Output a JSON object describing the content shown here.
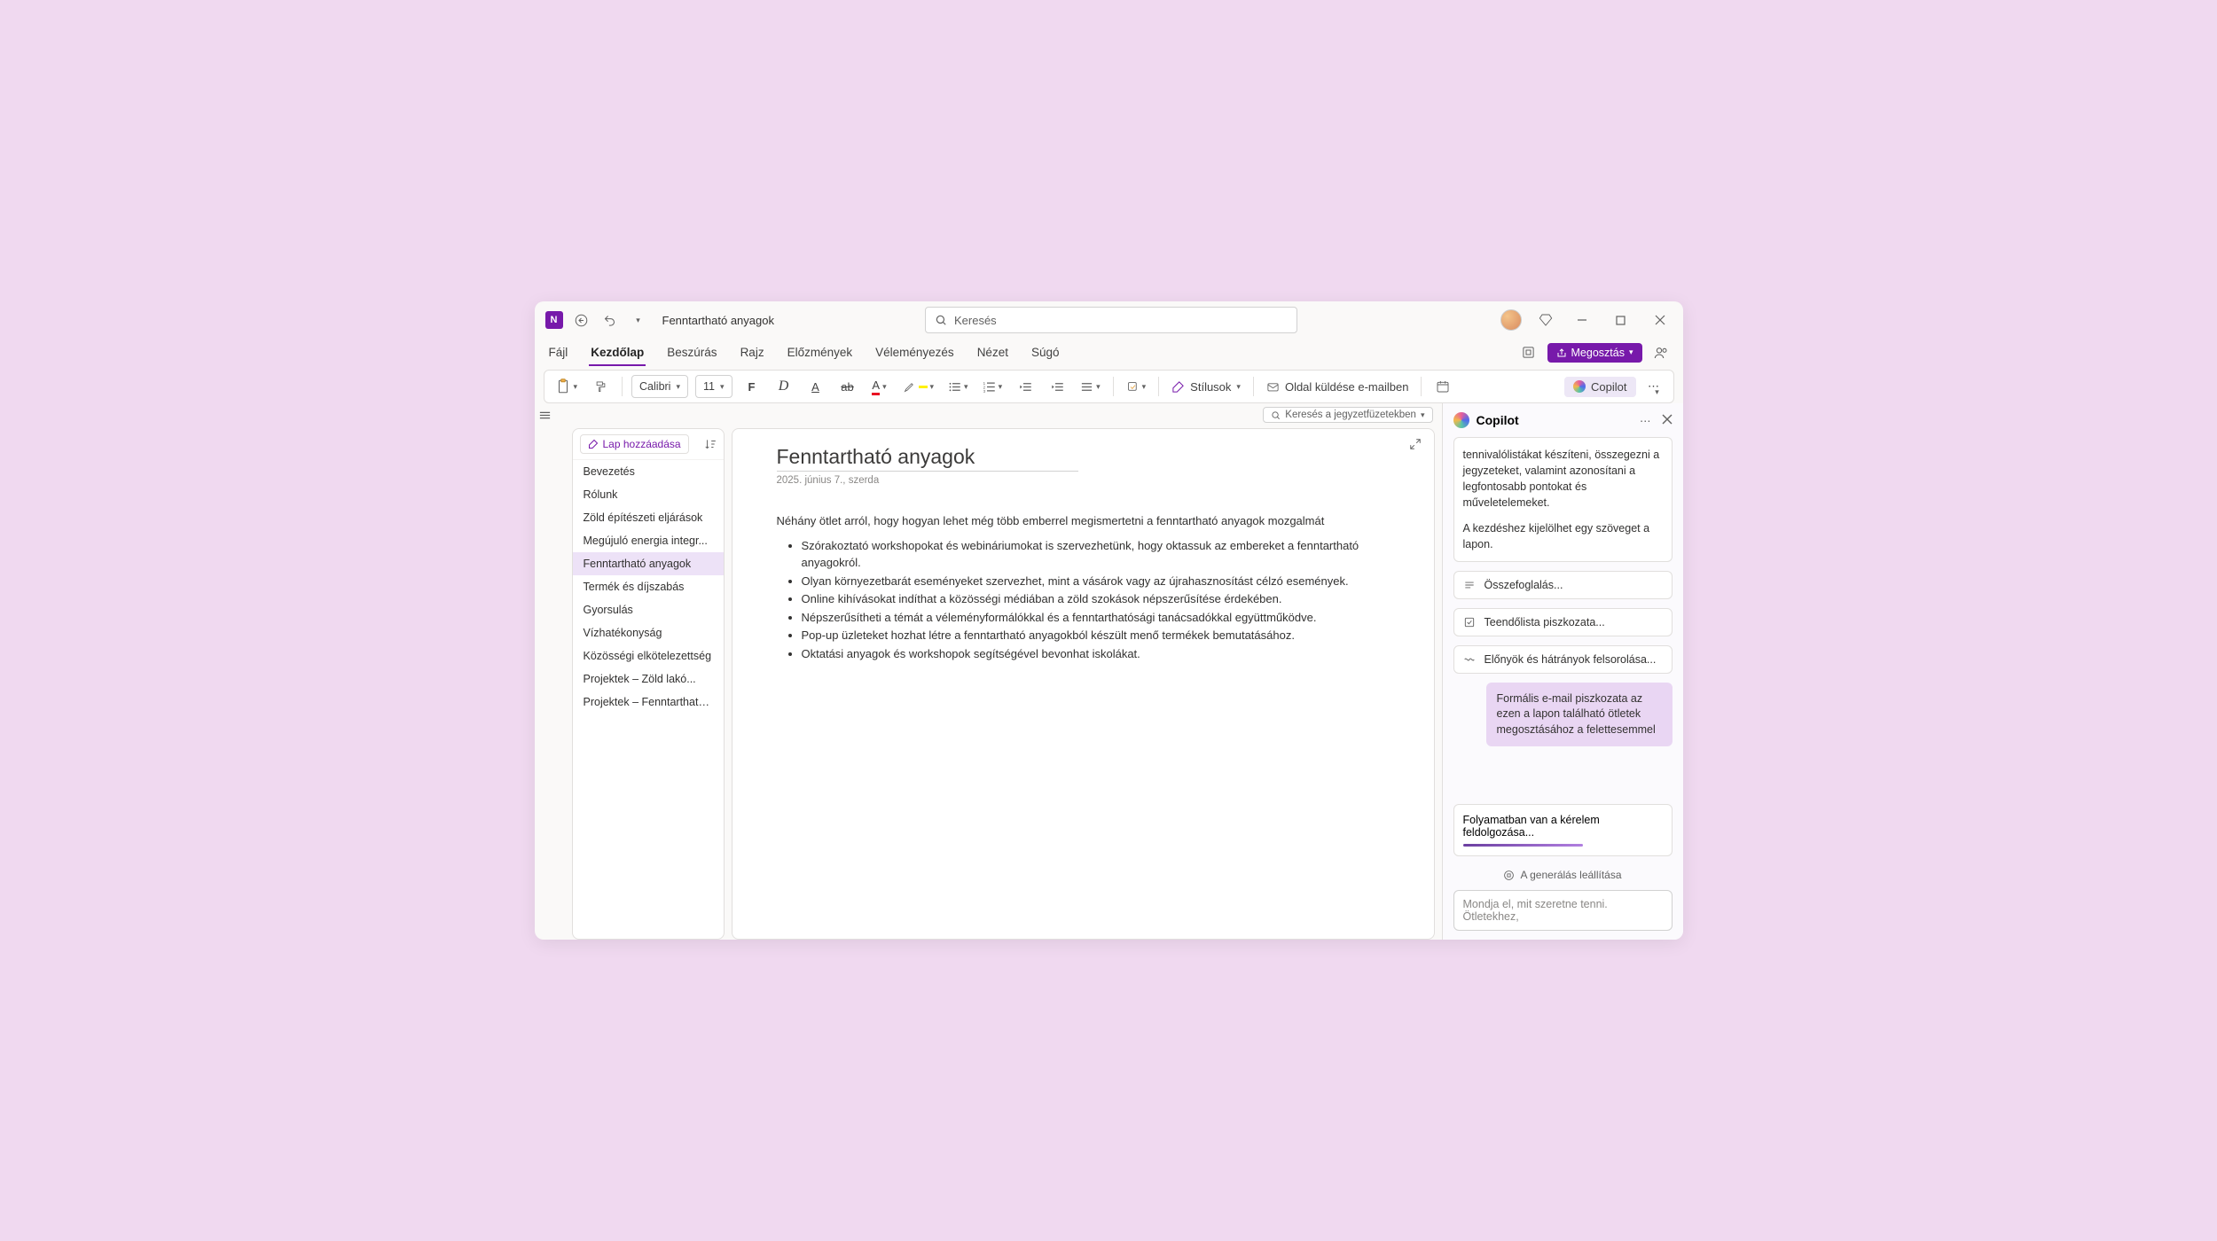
{
  "title_bar": {
    "document_title": "Fenntartható anyagok",
    "search_placeholder": "Keresés"
  },
  "menu_tabs": {
    "items": [
      "Fájl",
      "Kezdőlap",
      "Beszúrás",
      "Rajz",
      "Előzmények",
      "Véleményezés",
      "Nézet",
      "Súgó"
    ],
    "active_index": 1,
    "share_label": "Megosztás"
  },
  "ribbon": {
    "font_name": "Calibri",
    "font_size": "11",
    "styles_label": "Stílusok",
    "email_label": "Oldal küldése e-mailben",
    "copilot_label": "Copilot"
  },
  "notebook_search": {
    "label": "Keresés a jegyzetfüzetekben"
  },
  "page_list": {
    "add_label": "Lap hozzáadása",
    "items": [
      "Bevezetés",
      "Rólunk",
      "Zöld építészeti eljárások",
      "Megújuló energia integr...",
      "Fenntartható anyagok",
      "Termék és díjszabás",
      "Gyorsulás",
      "Vízhatékonyság",
      "Közösségi elkötelezettség",
      "Projektek – Zöld lakó...",
      "Projektek – Fenntartható..."
    ],
    "active_index": 4
  },
  "note": {
    "title": "Fenntartható anyagok",
    "date": "2025. június 7., szerda",
    "intro": "Néhány ötlet arról, hogy hogyan lehet még több emberrel megismertetni a fenntartható anyagok mozgalmát",
    "bullets": [
      "Szórakoztató workshopokat és webináriumokat is szervezhetünk, hogy oktassuk az embereket a fenntartható anyagokról.",
      "Olyan környezetbarát eseményeket szervezhet, mint a vásárok vagy az újrahasznosítást célzó események.",
      "Online kihívásokat indíthat a közösségi médiában a zöld szokások népszerűsítése érdekében.",
      "Népszerűsítheti a témát a véleményformálókkal és a fenntarthatósági tanácsadókkal együttműködve.",
      "Pop-up üzleteket hozhat létre a fenntartható anyagokból készült menő termékek bemutatásához.",
      "Oktatási anyagok és workshopok segítségével bevonhat iskolákat."
    ]
  },
  "copilot": {
    "pane_title": "Copilot",
    "intro_text": "tennivalólistákat készíteni, összegezni a jegyzeteket, valamint azonosítani a legfontosabb pontokat és műveletelemeket.",
    "intro_cta": "A kezdéshez kijelölhet egy szöveget a lapon.",
    "suggestions": [
      "Összefoglalás...",
      "Teendőlista piszkozata...",
      "Előnyök és hátrányok felsorolása..."
    ],
    "user_message": "Formális e-mail piszkozata az ezen a lapon található ötletek megosztásához a felettesemmel",
    "processing_label": "Folyamatban van a kérelem feldolgozása...",
    "stop_label": "A generálás leállítása",
    "input_placeholder": "Mondja el, mit szeretne tenni. Ötletekhez,"
  }
}
